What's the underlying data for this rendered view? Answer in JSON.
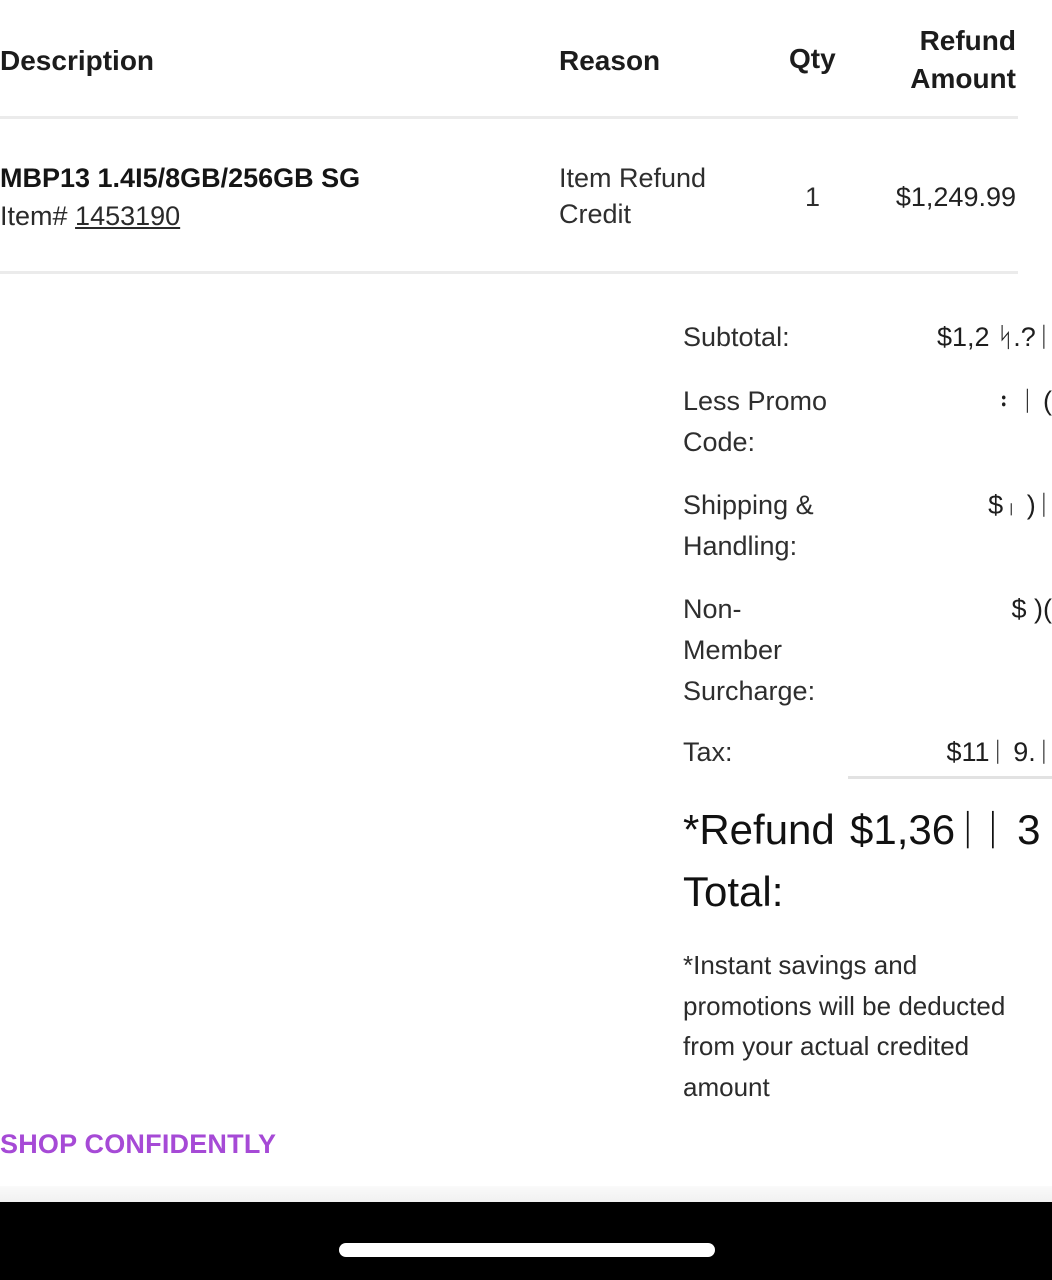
{
  "table": {
    "headers": {
      "description": "Description",
      "reason": "Reason",
      "qty": "Qty",
      "refund_amount_line1": "Refund",
      "refund_amount_line2": "Amount"
    },
    "rows": [
      {
        "description": "MBP13 1.4I5/8GB/256GB SG",
        "item_label": "Item#",
        "item_number": "1453190",
        "reason": "Item Refund Credit",
        "qty": "1",
        "refund_amount": "$1,249.99"
      }
    ]
  },
  "summary": {
    "subtotal_label": "Subtotal:",
    "subtotal_value": "$1,2 ᛋ.?ᛁ",
    "promo_label": "Less Promo Code:",
    "promo_value": "᛬ ᛁ (",
    "shipping_label": "Shipping & Handling:",
    "shipping_value": "$ᛧ )ᛁ",
    "nonmember_label": "Non- Member Surcharge:",
    "nonmember_value": "$  )(",
    "tax_label": "Tax:",
    "tax_value": "$11ᛁ 9.ᛁ",
    "total_label": "*Refund Total:",
    "total_value": "$1,36ᛁᛁ 3"
  },
  "note": "*Instant savings and promotions will be deducted from your actual credited amount",
  "footer": {
    "shop_confidently": "SHOP CONFIDENTLY"
  },
  "colors": {
    "accent": "#a64ad6",
    "nav_bar": "#000000",
    "divider": "#ebebeb"
  }
}
